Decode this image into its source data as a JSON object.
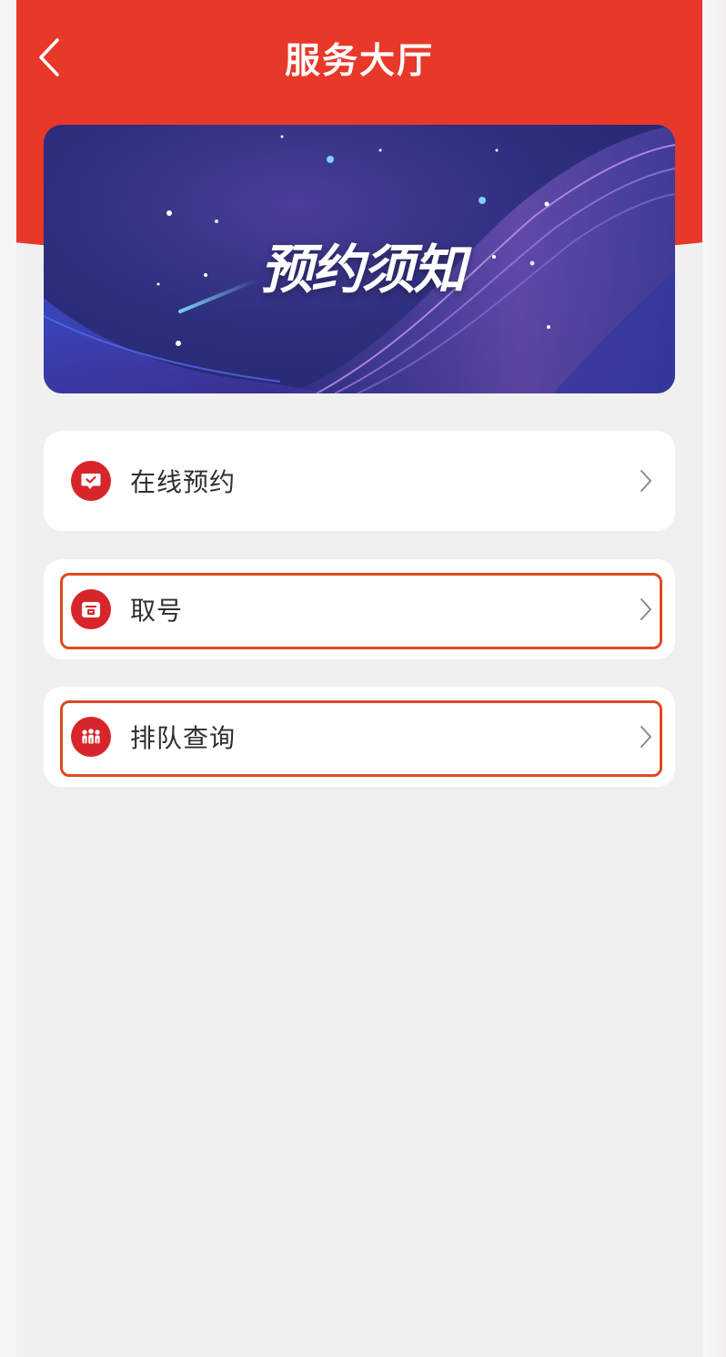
{
  "header": {
    "title": "服务大厅",
    "back_icon": "chevron-left-icon",
    "background_color": "#e8382a"
  },
  "banner": {
    "text": "预约须知"
  },
  "menu": [
    {
      "label": "在线预约",
      "icon": "calendar-check-icon",
      "outlined": false
    },
    {
      "label": "取号",
      "icon": "ticket-dispenser-icon",
      "outlined": true
    },
    {
      "label": "排队查询",
      "icon": "queue-people-icon",
      "outlined": true
    }
  ],
  "colors": {
    "accent": "#d7262b",
    "highlight_outline": "#e04a22"
  }
}
